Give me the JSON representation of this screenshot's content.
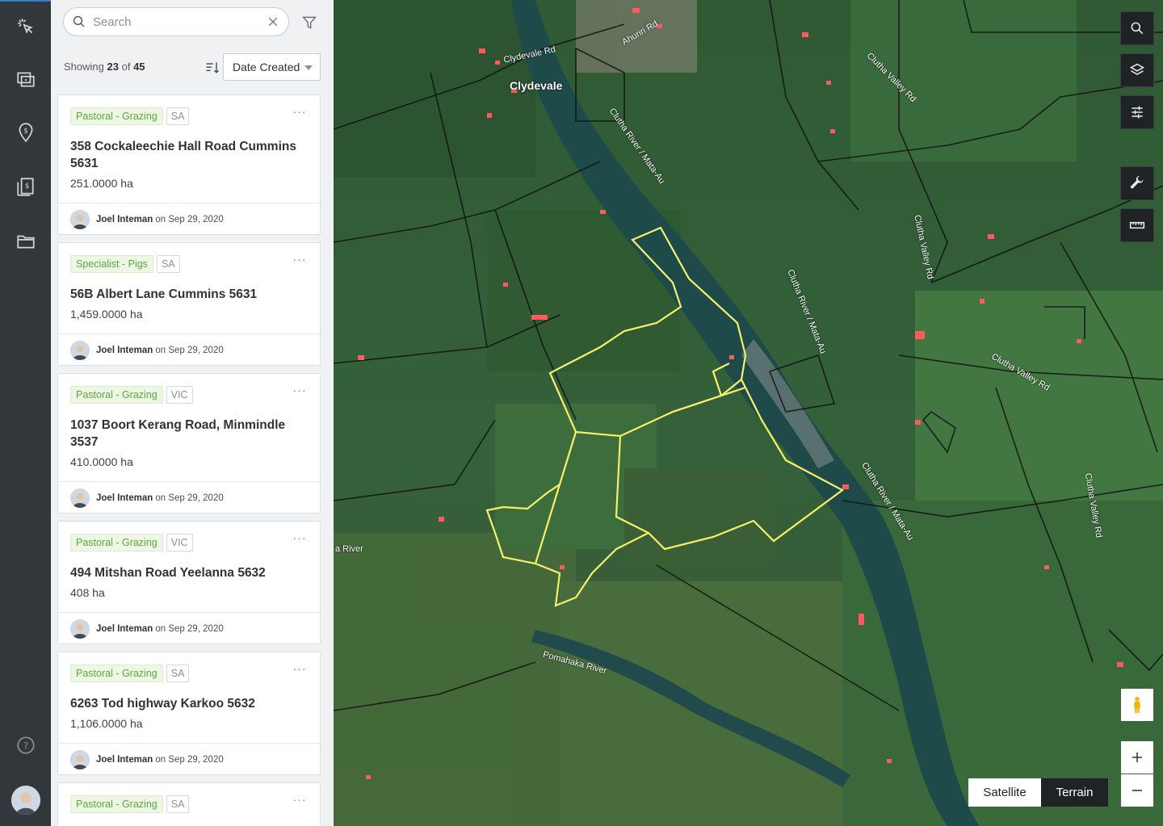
{
  "search": {
    "placeholder": "Search",
    "value": ""
  },
  "list_header": {
    "showing_prefix": "Showing",
    "shown": "23",
    "of_word": "of",
    "total": "45"
  },
  "sort": {
    "selected": "Date Created"
  },
  "listings": [
    {
      "type": "Pastoral - Grazing",
      "state": "SA",
      "address": "358 Cockaleechie Hall Road Cummins 5631",
      "area": "251.0000 ha",
      "author": "Joel Inteman",
      "on_word": "on",
      "date": "Sep 29, 2020"
    },
    {
      "type": "Specialist - Pigs",
      "state": "SA",
      "address": "56B Albert Lane Cummins 5631",
      "area": "1,459.0000 ha",
      "author": "Joel Inteman",
      "on_word": "on",
      "date": "Sep 29, 2020"
    },
    {
      "type": "Pastoral - Grazing",
      "state": "VIC",
      "address": "1037 Boort Kerang Road, Minmindle 3537",
      "area": "410.0000 ha",
      "author": "Joel Inteman",
      "on_word": "on",
      "date": "Sep 29, 2020"
    },
    {
      "type": "Pastoral - Grazing",
      "state": "VIC",
      "address": "494 Mitshan Road Yeelanna 5632",
      "area": "408 ha",
      "author": "Joel Inteman",
      "on_word": "on",
      "date": "Sep 29, 2020"
    },
    {
      "type": "Pastoral - Grazing",
      "state": "SA",
      "address": "6263 Tod highway Karkoo 5632",
      "area": "1,106.0000 ha",
      "author": "Joel Inteman",
      "on_word": "on",
      "date": "Sep 29, 2020"
    },
    {
      "type": "Pastoral - Grazing",
      "state": "SA"
    }
  ],
  "map": {
    "labels": {
      "town": "Clydevale",
      "river1": "Clutha River / Mata-Au",
      "river2": "Clutha River / Mata-Au",
      "river3": "Clutha River / Mata-Au",
      "river4": "Pomahaka River",
      "river5": "a River",
      "road1": "Clutha Valley Rd",
      "road2": "Clutha Valley Rd",
      "road3": "Clutha Valley Rd",
      "road4": "Clutha Valley Rd",
      "road5": "Clydevale Rd",
      "road6": "Ahuriri Rd"
    },
    "map_type_options": [
      "Satellite",
      "Terrain"
    ],
    "selected_map_type": "Terrain",
    "colors": {
      "parcel_highlight": "#f5f06a",
      "parcel_lines": "#111111",
      "building_marker": "#ff5a5f"
    }
  },
  "icons": {
    "rail": [
      "pointer-click-icon",
      "listings-icon",
      "location-dollar-icon",
      "ledger-dollar-icon",
      "folder-icon",
      "help-icon"
    ],
    "map_controls": [
      "search-icon",
      "layers-icon",
      "sliders-icon",
      "wrench-icon",
      "ruler-icon",
      "pegman-icon"
    ]
  }
}
